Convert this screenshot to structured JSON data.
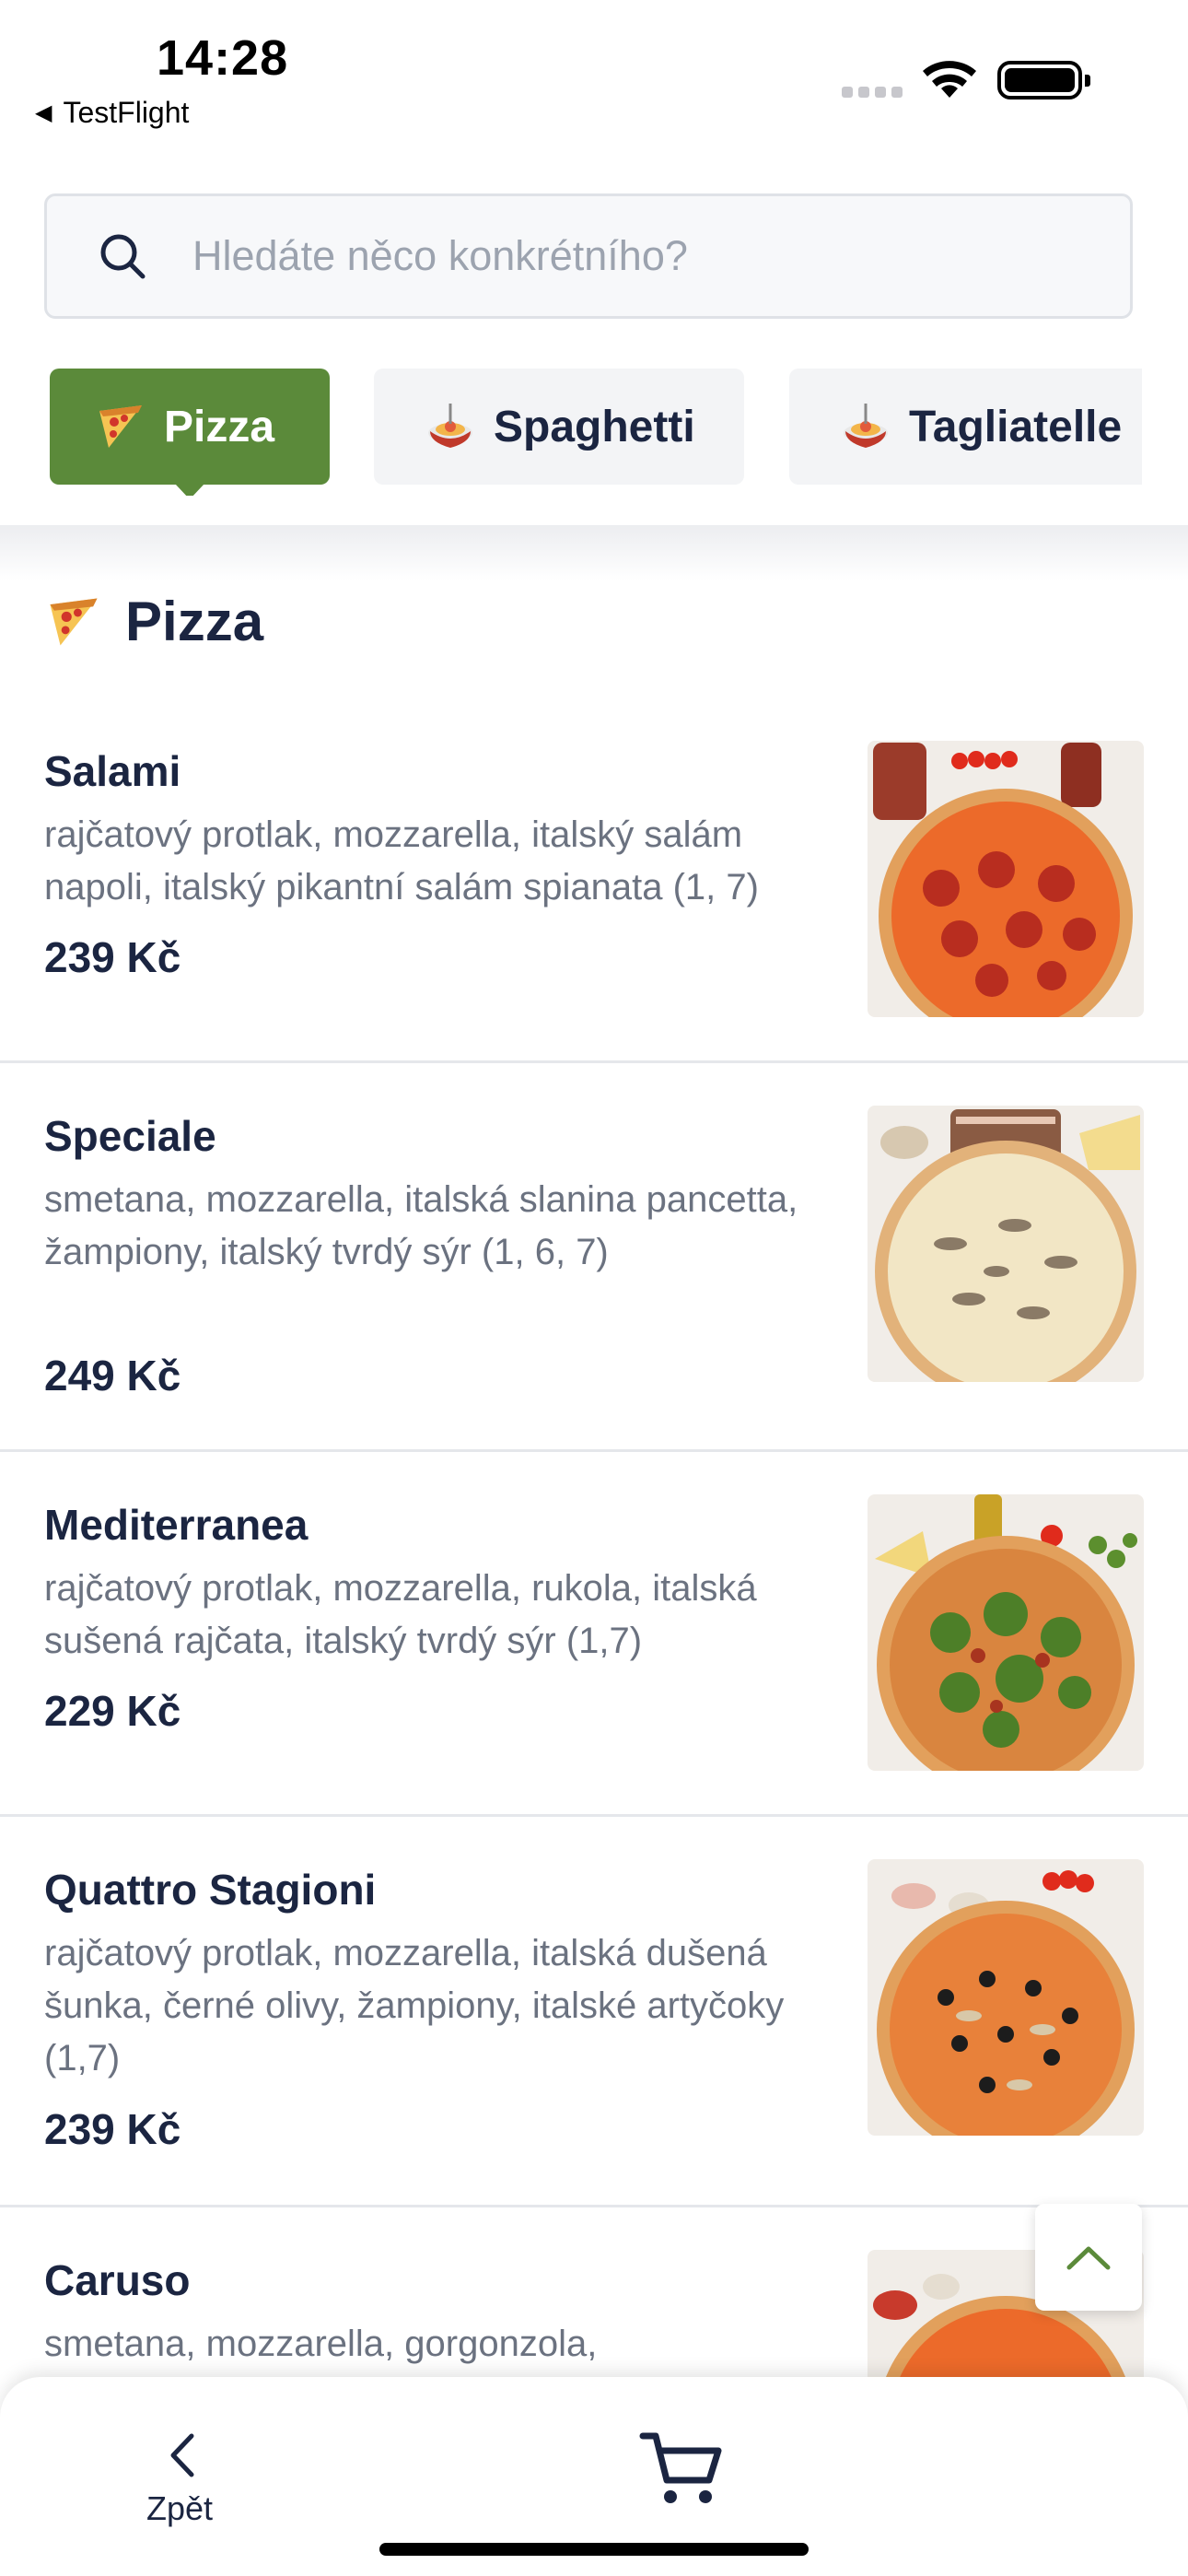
{
  "status_bar": {
    "time": "14:28",
    "back_app": "TestFlight"
  },
  "search": {
    "placeholder": "Hledáte něco konkrétního?"
  },
  "categories": [
    {
      "label": "Pizza",
      "icon": "pizza-icon",
      "active": true
    },
    {
      "label": "Spaghetti",
      "icon": "spaghetti-icon",
      "active": false
    },
    {
      "label": "Tagliatelle",
      "icon": "spaghetti-icon",
      "active": false
    }
  ],
  "section": {
    "title": "Pizza",
    "icon": "pizza-icon"
  },
  "items": [
    {
      "name": "Salami",
      "description": "rajčatový protlak, mozzarella, italský salám napoli, italský pikantní salám spianata (1, 7)",
      "price": "239 Kč"
    },
    {
      "name": "Speciale",
      "description": "smetana, mozzarella, italská slanina pancetta, žampiony, italský tvrdý sýr (1, 6, 7)",
      "price": "249 Kč"
    },
    {
      "name": "Mediterranea",
      "description": "rajčatový protlak, mozzarella, rukola, italská sušená rajčata, italský tvrdý sýr (1,7)",
      "price": "229 Kč"
    },
    {
      "name": "Quattro Stagioni",
      "description": "rajčatový protlak, mozzarella, italská dušená šunka, černé olivy, žampiony, italské artyčoky (1,7)",
      "price": "239 Kč"
    },
    {
      "name": "Caruso",
      "description": "smetana, mozzarella, gorgonzola,",
      "price": ""
    }
  ],
  "bottom_bar": {
    "back_label": "Zpět",
    "cart_icon": "cart-icon"
  },
  "colors": {
    "accent": "#5b8a3a",
    "text": "#1b2541",
    "muted": "#6b7280"
  }
}
